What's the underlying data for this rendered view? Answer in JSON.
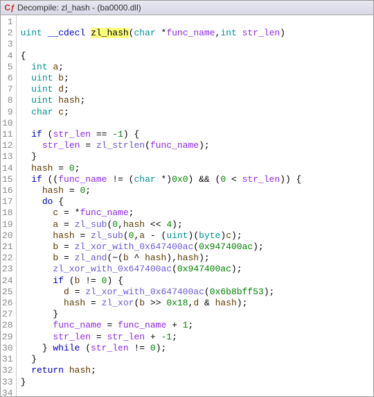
{
  "window": {
    "title": "Decompile: zl_hash - (ba0000.dll)",
    "icon_name": "decompile-icon",
    "icon_glyph": "Cƒ"
  },
  "code": {
    "lines": [
      {
        "n": 1,
        "segs": []
      },
      {
        "n": 2,
        "segs": [
          {
            "t": "uint",
            "c": "type"
          },
          {
            "t": " ",
            "c": ""
          },
          {
            "t": "__cdecl",
            "c": "kw"
          },
          {
            "t": " ",
            "c": ""
          },
          {
            "t": "zl_hash",
            "c": "hlname"
          },
          {
            "t": "(",
            "c": "paren"
          },
          {
            "t": "char",
            "c": "type"
          },
          {
            "t": " *",
            "c": ""
          },
          {
            "t": "func_name",
            "c": "param"
          },
          {
            "t": ",",
            "c": ""
          },
          {
            "t": "int",
            "c": "type"
          },
          {
            "t": " ",
            "c": ""
          },
          {
            "t": "str_len",
            "c": "param"
          },
          {
            "t": ")",
            "c": "paren"
          }
        ]
      },
      {
        "n": 3,
        "segs": []
      },
      {
        "n": 4,
        "segs": [
          {
            "t": "{",
            "c": ""
          }
        ]
      },
      {
        "n": 5,
        "segs": [
          {
            "t": "  ",
            "c": ""
          },
          {
            "t": "int",
            "c": "type"
          },
          {
            "t": " ",
            "c": ""
          },
          {
            "t": "a",
            "c": "var"
          },
          {
            "t": ";",
            "c": ""
          }
        ]
      },
      {
        "n": 6,
        "segs": [
          {
            "t": "  ",
            "c": ""
          },
          {
            "t": "uint",
            "c": "type"
          },
          {
            "t": " ",
            "c": ""
          },
          {
            "t": "b",
            "c": "var"
          },
          {
            "t": ";",
            "c": ""
          }
        ]
      },
      {
        "n": 7,
        "segs": [
          {
            "t": "  ",
            "c": ""
          },
          {
            "t": "uint",
            "c": "type"
          },
          {
            "t": " ",
            "c": ""
          },
          {
            "t": "d",
            "c": "var"
          },
          {
            "t": ";",
            "c": ""
          }
        ]
      },
      {
        "n": 8,
        "segs": [
          {
            "t": "  ",
            "c": ""
          },
          {
            "t": "uint",
            "c": "type"
          },
          {
            "t": " ",
            "c": ""
          },
          {
            "t": "hash",
            "c": "var"
          },
          {
            "t": ";",
            "c": ""
          }
        ]
      },
      {
        "n": 9,
        "segs": [
          {
            "t": "  ",
            "c": ""
          },
          {
            "t": "char",
            "c": "type"
          },
          {
            "t": " ",
            "c": ""
          },
          {
            "t": "c",
            "c": "var"
          },
          {
            "t": ";",
            "c": ""
          }
        ]
      },
      {
        "n": 10,
        "segs": []
      },
      {
        "n": 11,
        "segs": [
          {
            "t": "  ",
            "c": ""
          },
          {
            "t": "if",
            "c": "kw"
          },
          {
            "t": " (",
            "c": ""
          },
          {
            "t": "str_len",
            "c": "param"
          },
          {
            "t": " == ",
            "c": ""
          },
          {
            "t": "-1",
            "c": "num"
          },
          {
            "t": ") {",
            "c": ""
          }
        ]
      },
      {
        "n": 12,
        "segs": [
          {
            "t": "    ",
            "c": ""
          },
          {
            "t": "str_len",
            "c": "param"
          },
          {
            "t": " = ",
            "c": ""
          },
          {
            "t": "zl_strlen",
            "c": "glob"
          },
          {
            "t": "(",
            "c": ""
          },
          {
            "t": "func_name",
            "c": "param"
          },
          {
            "t": ");",
            "c": ""
          }
        ]
      },
      {
        "n": 13,
        "segs": [
          {
            "t": "  }",
            "c": ""
          }
        ]
      },
      {
        "n": 14,
        "segs": [
          {
            "t": "  ",
            "c": ""
          },
          {
            "t": "hash",
            "c": "var"
          },
          {
            "t": " = ",
            "c": ""
          },
          {
            "t": "0",
            "c": "num"
          },
          {
            "t": ";",
            "c": ""
          }
        ]
      },
      {
        "n": 15,
        "segs": [
          {
            "t": "  ",
            "c": ""
          },
          {
            "t": "if",
            "c": "kw"
          },
          {
            "t": " ((",
            "c": ""
          },
          {
            "t": "func_name",
            "c": "param"
          },
          {
            "t": " != (",
            "c": ""
          },
          {
            "t": "char",
            "c": "type"
          },
          {
            "t": " *)",
            "c": ""
          },
          {
            "t": "0x0",
            "c": "num"
          },
          {
            "t": ") && (",
            "c": ""
          },
          {
            "t": "0",
            "c": "num"
          },
          {
            "t": " < ",
            "c": ""
          },
          {
            "t": "str_len",
            "c": "param"
          },
          {
            "t": ")) {",
            "c": ""
          }
        ]
      },
      {
        "n": 16,
        "segs": [
          {
            "t": "    ",
            "c": ""
          },
          {
            "t": "hash",
            "c": "var"
          },
          {
            "t": " = ",
            "c": ""
          },
          {
            "t": "0",
            "c": "num"
          },
          {
            "t": ";",
            "c": ""
          }
        ]
      },
      {
        "n": 17,
        "segs": [
          {
            "t": "    ",
            "c": ""
          },
          {
            "t": "do",
            "c": "kw"
          },
          {
            "t": " {",
            "c": ""
          }
        ]
      },
      {
        "n": 18,
        "segs": [
          {
            "t": "      ",
            "c": ""
          },
          {
            "t": "c",
            "c": "var"
          },
          {
            "t": " = *",
            "c": ""
          },
          {
            "t": "func_name",
            "c": "param"
          },
          {
            "t": ";",
            "c": ""
          }
        ]
      },
      {
        "n": 19,
        "segs": [
          {
            "t": "      ",
            "c": ""
          },
          {
            "t": "a",
            "c": "var"
          },
          {
            "t": " = ",
            "c": ""
          },
          {
            "t": "zl_sub",
            "c": "glob"
          },
          {
            "t": "(",
            "c": ""
          },
          {
            "t": "0",
            "c": "num"
          },
          {
            "t": ",",
            "c": ""
          },
          {
            "t": "hash",
            "c": "var"
          },
          {
            "t": " << ",
            "c": ""
          },
          {
            "t": "4",
            "c": "num"
          },
          {
            "t": ");",
            "c": ""
          }
        ]
      },
      {
        "n": 20,
        "segs": [
          {
            "t": "      ",
            "c": ""
          },
          {
            "t": "hash",
            "c": "var"
          },
          {
            "t": " = ",
            "c": ""
          },
          {
            "t": "zl_sub",
            "c": "glob"
          },
          {
            "t": "(",
            "c": ""
          },
          {
            "t": "0",
            "c": "num"
          },
          {
            "t": ",",
            "c": ""
          },
          {
            "t": "a",
            "c": "var"
          },
          {
            "t": " - (",
            "c": ""
          },
          {
            "t": "uint",
            "c": "type"
          },
          {
            "t": ")(",
            "c": ""
          },
          {
            "t": "byte",
            "c": "type"
          },
          {
            "t": ")",
            "c": ""
          },
          {
            "t": "c",
            "c": "var"
          },
          {
            "t": ");",
            "c": ""
          }
        ]
      },
      {
        "n": 21,
        "segs": [
          {
            "t": "      ",
            "c": ""
          },
          {
            "t": "b",
            "c": "var"
          },
          {
            "t": " = ",
            "c": ""
          },
          {
            "t": "zl_xor_with_0x647400ac",
            "c": "glob"
          },
          {
            "t": "(",
            "c": ""
          },
          {
            "t": "0x947400ac",
            "c": "num"
          },
          {
            "t": ");",
            "c": ""
          }
        ]
      },
      {
        "n": 22,
        "segs": [
          {
            "t": "      ",
            "c": ""
          },
          {
            "t": "b",
            "c": "var"
          },
          {
            "t": " = ",
            "c": ""
          },
          {
            "t": "zl_and",
            "c": "glob"
          },
          {
            "t": "(~(",
            "c": ""
          },
          {
            "t": "b",
            "c": "var"
          },
          {
            "t": " ^ ",
            "c": ""
          },
          {
            "t": "hash",
            "c": "var"
          },
          {
            "t": "),",
            "c": ""
          },
          {
            "t": "hash",
            "c": "var"
          },
          {
            "t": ");",
            "c": ""
          }
        ]
      },
      {
        "n": 23,
        "segs": [
          {
            "t": "      ",
            "c": ""
          },
          {
            "t": "zl_xor_with_0x647400ac",
            "c": "glob"
          },
          {
            "t": "(",
            "c": ""
          },
          {
            "t": "0x947400ac",
            "c": "num"
          },
          {
            "t": ");",
            "c": ""
          }
        ]
      },
      {
        "n": 24,
        "segs": [
          {
            "t": "      ",
            "c": ""
          },
          {
            "t": "if",
            "c": "kw"
          },
          {
            "t": " (",
            "c": ""
          },
          {
            "t": "b",
            "c": "var"
          },
          {
            "t": " != ",
            "c": ""
          },
          {
            "t": "0",
            "c": "num"
          },
          {
            "t": ") {",
            "c": ""
          }
        ]
      },
      {
        "n": 25,
        "segs": [
          {
            "t": "        ",
            "c": ""
          },
          {
            "t": "d",
            "c": "var"
          },
          {
            "t": " = ",
            "c": ""
          },
          {
            "t": "zl_xor_with_0x647400ac",
            "c": "glob"
          },
          {
            "t": "(",
            "c": ""
          },
          {
            "t": "0x6b8bff53",
            "c": "num"
          },
          {
            "t": ");",
            "c": ""
          }
        ]
      },
      {
        "n": 26,
        "segs": [
          {
            "t": "        ",
            "c": ""
          },
          {
            "t": "hash",
            "c": "var"
          },
          {
            "t": " = ",
            "c": ""
          },
          {
            "t": "zl_xor",
            "c": "glob"
          },
          {
            "t": "(",
            "c": ""
          },
          {
            "t": "b",
            "c": "var"
          },
          {
            "t": " >> ",
            "c": ""
          },
          {
            "t": "0x18",
            "c": "num"
          },
          {
            "t": ",",
            "c": ""
          },
          {
            "t": "d",
            "c": "var"
          },
          {
            "t": " & ",
            "c": ""
          },
          {
            "t": "hash",
            "c": "var"
          },
          {
            "t": ");",
            "c": ""
          }
        ]
      },
      {
        "n": 27,
        "segs": [
          {
            "t": "      }",
            "c": ""
          }
        ]
      },
      {
        "n": 28,
        "segs": [
          {
            "t": "      ",
            "c": ""
          },
          {
            "t": "func_name",
            "c": "param"
          },
          {
            "t": " = ",
            "c": ""
          },
          {
            "t": "func_name",
            "c": "param"
          },
          {
            "t": " + ",
            "c": ""
          },
          {
            "t": "1",
            "c": "num"
          },
          {
            "t": ";",
            "c": ""
          }
        ]
      },
      {
        "n": 29,
        "segs": [
          {
            "t": "      ",
            "c": ""
          },
          {
            "t": "str_len",
            "c": "param"
          },
          {
            "t": " = ",
            "c": ""
          },
          {
            "t": "str_len",
            "c": "param"
          },
          {
            "t": " + ",
            "c": ""
          },
          {
            "t": "-1",
            "c": "num"
          },
          {
            "t": ";",
            "c": ""
          }
        ]
      },
      {
        "n": 30,
        "segs": [
          {
            "t": "    } ",
            "c": ""
          },
          {
            "t": "while",
            "c": "kw"
          },
          {
            "t": " (",
            "c": ""
          },
          {
            "t": "str_len",
            "c": "param"
          },
          {
            "t": " != ",
            "c": ""
          },
          {
            "t": "0",
            "c": "num"
          },
          {
            "t": ");",
            "c": ""
          }
        ]
      },
      {
        "n": 31,
        "segs": [
          {
            "t": "  }",
            "c": ""
          }
        ]
      },
      {
        "n": 32,
        "segs": [
          {
            "t": "  ",
            "c": ""
          },
          {
            "t": "return",
            "c": "kw"
          },
          {
            "t": " ",
            "c": ""
          },
          {
            "t": "hash",
            "c": "var"
          },
          {
            "t": ";",
            "c": ""
          }
        ]
      },
      {
        "n": 33,
        "segs": [
          {
            "t": "}",
            "c": ""
          }
        ]
      },
      {
        "n": 34,
        "segs": []
      }
    ]
  }
}
